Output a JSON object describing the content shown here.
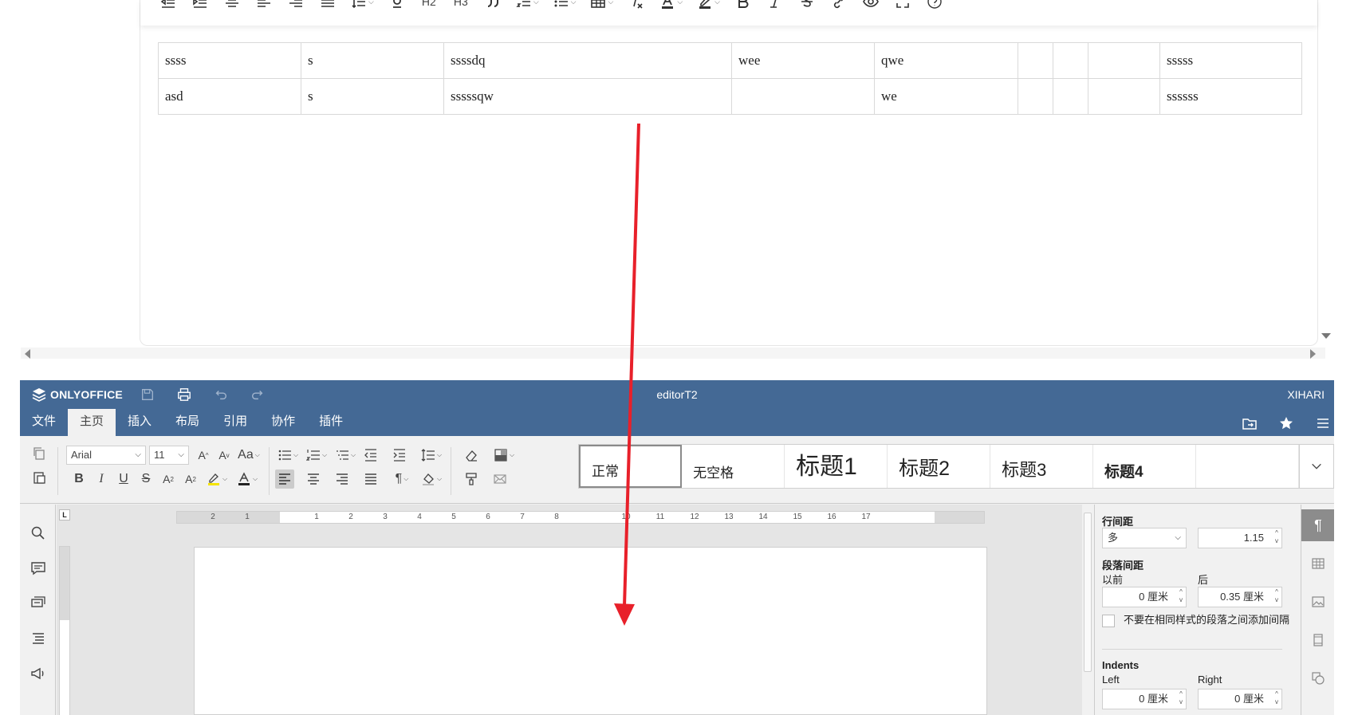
{
  "top_editor": {
    "toolbar": {
      "h2": "H2",
      "h3": "H3"
    },
    "table": [
      [
        "ssss",
        "s",
        "ssssdq",
        "wee",
        "qwe",
        "",
        "",
        "",
        "sssss"
      ],
      [
        "asd",
        "s",
        "sssssqw",
        "",
        "we",
        "",
        "",
        "",
        "ssssss"
      ]
    ]
  },
  "onlyoffice": {
    "logo": "ONLYOFFICE",
    "doc_title": "editorT2",
    "user": "XIHARI",
    "tabs": [
      "文件",
      "主页",
      "插入",
      "布局",
      "引用",
      "协作",
      "插件"
    ],
    "active_tab": "主页",
    "font_name": "Arial",
    "font_size": "11",
    "styles": [
      "正常",
      "无空格",
      "标题1",
      "标题2",
      "标题3",
      "标题4",
      ""
    ],
    "ruler_labels": [
      "2",
      "1",
      "1",
      "2",
      "3",
      "4",
      "5",
      "6",
      "7",
      "8",
      "10",
      "11",
      "12",
      "13",
      "14",
      "15",
      "16",
      "17"
    ],
    "corner": "L",
    "paragraph": {
      "line_spacing_title": "行间距",
      "line_spacing_mode": "多",
      "line_spacing_value": "1.15",
      "spacing_title": "段落间距",
      "before_label": "以前",
      "after_label": "后",
      "before_value": "0 厘米",
      "after_value": "0.35 厘米",
      "no_space_label": "不要在相同样式的段落之间添加间隔",
      "indents_title": "Indents",
      "left_label": "Left",
      "right_label": "Right",
      "left_value": "0 厘米",
      "right_value": "0 厘米"
    }
  },
  "colors": {
    "onlyoffice_header": "#446995",
    "annotation_arrow": "#e8202a"
  }
}
